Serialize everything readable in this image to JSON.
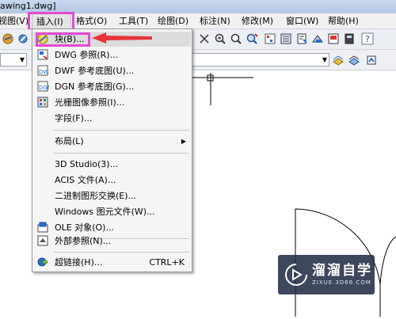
{
  "window": {
    "title": "awing1.dwg]"
  },
  "menubar": {
    "items": [
      {
        "label": "视图(V)"
      },
      {
        "label": "插入(I)"
      },
      {
        "label": "格式(O)"
      },
      {
        "label": "工具(T)"
      },
      {
        "label": "绘图(D)"
      },
      {
        "label": "标注(N)"
      },
      {
        "label": "修改(M)"
      },
      {
        "label": "窗口(W)"
      },
      {
        "label": "帮助(H)"
      }
    ]
  },
  "insert_menu": {
    "items": [
      {
        "label": "块(B)...",
        "icon": "block-icon"
      },
      {
        "label": "DWG 参照(R)...",
        "icon": "dwg-reference-icon"
      },
      {
        "label": "DWF 参考底图(U)...",
        "icon": "dwf-underlay-icon"
      },
      {
        "label": "DGN 参考底图(G)...",
        "icon": "dgn-underlay-icon"
      },
      {
        "label": "光栅图像参照(I)...",
        "icon": "raster-image-icon"
      },
      {
        "label": "字段(F)..."
      },
      {
        "label": "布局(L)",
        "submenu": true
      },
      {
        "label": "3D Studio(3)..."
      },
      {
        "label": "ACIS 文件(A)..."
      },
      {
        "label": "二进制图形交换(E)..."
      },
      {
        "label": "Windows 图元文件(W)..."
      },
      {
        "label": "OLE 对象(O)...",
        "icon": "ole-object-icon"
      },
      {
        "label": "外部参照(N)...",
        "icon": "external-reference-icon"
      },
      {
        "label": "超链接(H)...",
        "icon": "hyperlink-icon",
        "shortcut": "CTRL+K"
      }
    ]
  },
  "watermark": {
    "title": "溜溜自学",
    "subtitle": "ZIXUE.3D66.COM"
  },
  "colors": {
    "highlight": "#e24bd2",
    "arrow": "#e8333a"
  }
}
